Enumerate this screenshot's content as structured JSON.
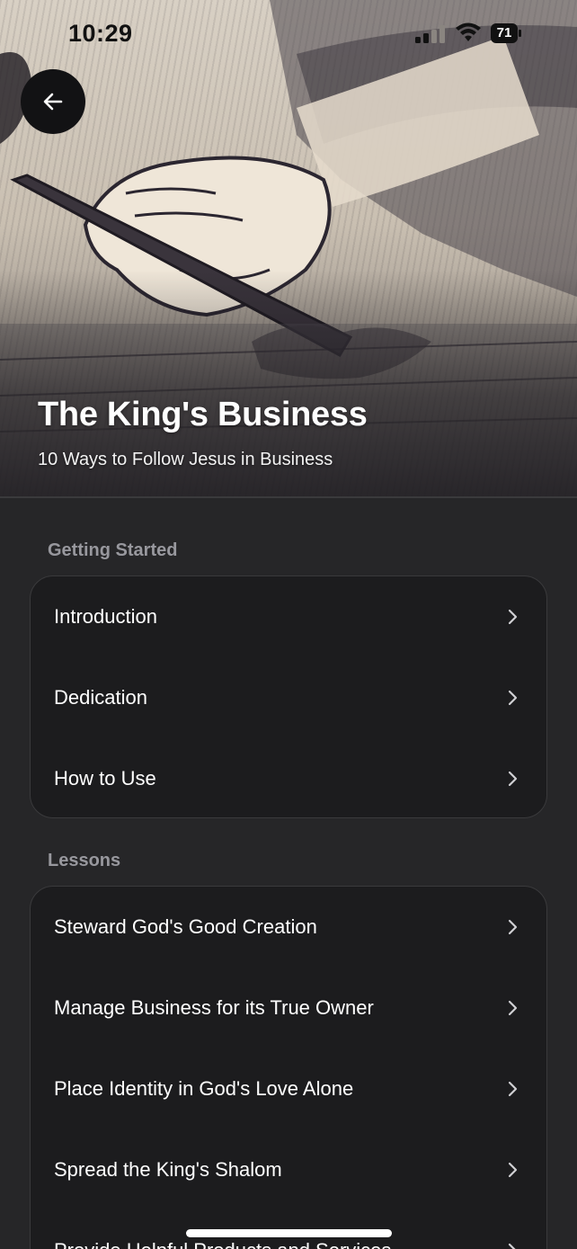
{
  "status_bar": {
    "time": "10:29",
    "battery_level": "71",
    "icons": [
      "signal-icon",
      "wifi-icon",
      "battery-icon"
    ]
  },
  "hero": {
    "title": "The King's Business",
    "subtitle": "10 Ways to Follow Jesus in Business",
    "image_icon": "woodcut-illustration",
    "back_icon": "arrow-left-icon"
  },
  "sections": [
    {
      "header": "Getting Started",
      "items": [
        {
          "label": "Introduction"
        },
        {
          "label": "Dedication"
        },
        {
          "label": "How to Use"
        }
      ]
    },
    {
      "header": "Lessons",
      "items": [
        {
          "label": "Steward God's Good Creation"
        },
        {
          "label": "Manage Business for its True Owner"
        },
        {
          "label": "Place Identity in God's Love Alone"
        },
        {
          "label": "Spread the King's Shalom"
        },
        {
          "label": "Provide Helpful Products and Services"
        }
      ]
    }
  ],
  "colors": {
    "background": "#262628",
    "card": "#1c1c1e",
    "card_border": "#3a3a3c",
    "section_header": "#98989e",
    "text": "#ffffff"
  }
}
